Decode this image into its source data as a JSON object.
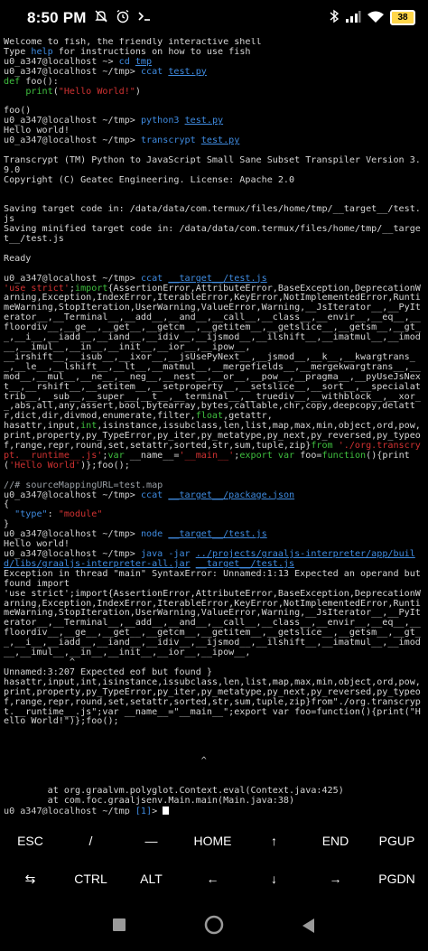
{
  "status_bar": {
    "time": "8:50 PM",
    "battery": "38",
    "icons": [
      "notifications-off-icon",
      "alarm-icon",
      "terminal-icon",
      "bluetooth-icon",
      "signal-icon",
      "wifi-icon",
      "battery-icon"
    ]
  },
  "terminal": {
    "lines": [
      [
        {
          "t": "Welcome to fish, the friendly interactive shell"
        }
      ],
      [
        {
          "t": "Type "
        },
        {
          "t": "help",
          "c": "cmd"
        },
        {
          "t": " for instructions on how to use fish"
        }
      ],
      [
        {
          "t": "u0_a347@localhost ~> ",
          "c": "prompt"
        },
        {
          "t": "cd ",
          "c": "cmd"
        },
        {
          "t": "tmp",
          "c": "file"
        }
      ],
      [
        {
          "t": "u0_a347@localhost ~/tmp> ",
          "c": "prompt"
        },
        {
          "t": "ccat ",
          "c": "cmd"
        },
        {
          "t": "test.py",
          "c": "file"
        }
      ],
      [
        {
          "t": "def",
          "c": "kw"
        },
        {
          "t": " foo():"
        }
      ],
      [
        {
          "t": "    "
        },
        {
          "t": "print",
          "c": "kw"
        },
        {
          "t": "("
        },
        {
          "t": "\"Hello World!\"",
          "c": "str"
        },
        {
          "t": ")"
        }
      ],
      [
        {
          "t": ""
        }
      ],
      [
        {
          "t": "foo()"
        }
      ],
      [
        {
          "t": "u0_a347@localhost ~/tmp> ",
          "c": "prompt"
        },
        {
          "t": "python3 ",
          "c": "cmd"
        },
        {
          "t": "test.py",
          "c": "file"
        }
      ],
      [
        {
          "t": "Hello world!"
        }
      ],
      [
        {
          "t": "u0_a347@localhost ~/tmp> ",
          "c": "prompt"
        },
        {
          "t": "transcrypt ",
          "c": "cmd"
        },
        {
          "t": "test.py",
          "c": "file"
        }
      ],
      [
        {
          "t": ""
        }
      ],
      [
        {
          "t": "Transcrypt (TM) Python to JavaScript Small Sane Subset Transpiler Version 3.9.0"
        }
      ],
      [
        {
          "t": "Copyright (C) Geatec Engineering. License: Apache 2.0"
        }
      ],
      [
        {
          "t": ""
        }
      ],
      [
        {
          "t": ""
        }
      ],
      [
        {
          "t": "Saving target code in: /data/data/com.termux/files/home/tmp/__target__/test.js"
        }
      ],
      [
        {
          "t": "Saving minified target code in: /data/data/com.termux/files/home/tmp/__target__/test.js"
        }
      ],
      [
        {
          "t": ""
        }
      ],
      [
        {
          "t": "Ready"
        }
      ],
      [
        {
          "t": ""
        }
      ],
      [
        {
          "t": "u0_a347@localhost ~/tmp> ",
          "c": "prompt"
        },
        {
          "t": "ccat ",
          "c": "cmd"
        },
        {
          "t": "__target__/test.js",
          "c": "file"
        }
      ],
      [
        {
          "t": "'use strict'",
          "c": "str"
        },
        {
          "t": ";"
        },
        {
          "t": "import",
          "c": "kw"
        },
        {
          "t": "{AssertionError,AttributeError,BaseException,DeprecationWarning,Exception,IndexError,IterableError,KeyError,NotImplementedError,RuntimeWarning,StopIteration,UserWarning,ValueError,Warning,__JsIterator__,__PyIterator__,__Terminal__,__add__,__and__,__call__,__class__,__envir__,__eq__,__floordiv__,__ge__,__get__,__getcm__,__getitem__,__getslice__,__getsm__,__gt__,__i__,__iadd__,__iand__,__idiv__,__ijsmod__,__ilshift__,__imatmul__,__imod__,__imul__,__in__,__init__,__ior__,__ipow__,"
        }
      ],
      [
        {
          "t": "__irshift__,__isub__,__ixor__,__jsUsePyNext__,__jsmod__,__k__,__kwargtrans__,__le__,__lshift__,__lt__,__matmul__,__mergefields__,__mergekwargtrans__,__mod__,__mul__,__ne__,__neg__,__nest__,__or__,__pow__,__pragma__,__pyUseJsNext__,__rshift__,__setitem__,__setproperty__,__setslice__,__sort__,__specialattrib__,__sub__,__super__,__t__,__terminal__,__truediv__,__withblock__,__xor__,abs,all,any,assert,bool,bytearray,bytes,callable,chr,copy,deepcopy,delattr,dict,dir,divmod,enumerate,filter,"
        },
        {
          "t": "float",
          "c": "kw"
        },
        {
          "t": ",getattr,"
        }
      ],
      [
        {
          "t": "hasattr,input,"
        },
        {
          "t": "int",
          "c": "kw"
        },
        {
          "t": ",isinstance,issubclass,len,list,map,max,min,object,ord,pow,print,property,py_TypeError,py_iter,py_metatype,py_next,py_reversed,py_typeof,range,repr,round,set,setattr,sorted,str,sum,tuple,zip}"
        },
        {
          "t": "from",
          "c": "kw"
        },
        {
          "t": " "
        },
        {
          "t": "'./org.transcrypt.__runtime__.js'",
          "c": "str"
        },
        {
          "t": ";"
        },
        {
          "t": "var",
          "c": "kw"
        },
        {
          "t": " __name__="
        },
        {
          "t": "'__main__'",
          "c": "str"
        },
        {
          "t": ";"
        },
        {
          "t": "export",
          "c": "kw"
        },
        {
          "t": " "
        },
        {
          "t": "var",
          "c": "kw"
        },
        {
          "t": " foo="
        },
        {
          "t": "function",
          "c": "kw"
        },
        {
          "t": "(){print("
        },
        {
          "t": "'Hello World'",
          "c": "str"
        },
        {
          "t": ")};foo();"
        }
      ],
      [
        {
          "t": ""
        }
      ],
      [
        {
          "t": "//# sourceMappingURL=test.map",
          "c": "dim"
        }
      ],
      [
        {
          "t": "u0_a347@localhost ~/tmp> ",
          "c": "prompt"
        },
        {
          "t": "ccat ",
          "c": "cmd"
        },
        {
          "t": "__target__/package.json",
          "c": "file"
        }
      ],
      [
        {
          "t": "{"
        }
      ],
      [
        {
          "t": "  "
        },
        {
          "t": "\"type\"",
          "c": "cmd"
        },
        {
          "t": ": "
        },
        {
          "t": "\"module\"",
          "c": "str"
        }
      ],
      [
        {
          "t": "}"
        }
      ],
      [
        {
          "t": "u0_a347@localhost ~/tmp> ",
          "c": "prompt"
        },
        {
          "t": "node ",
          "c": "cmd"
        },
        {
          "t": "__target__/test.js",
          "c": "file"
        }
      ],
      [
        {
          "t": "Hello world!"
        }
      ],
      [
        {
          "t": "u0_a347@localhost ~/tmp> ",
          "c": "prompt"
        },
        {
          "t": "java ",
          "c": "cmd"
        },
        {
          "t": "-jar ",
          "c": "cmd"
        },
        {
          "t": "../projects/graaljs-interpreter/app/build/libs/graaljs-interpreter-all.jar",
          "c": "file"
        },
        {
          "t": " "
        },
        {
          "t": "__target__/test.js",
          "c": "file"
        }
      ],
      [
        {
          "t": "Exception in thread \"main\" SyntaxError: Unnamed:1:13 Expected an operand but found import"
        }
      ],
      [
        {
          "t": "'use strict';import{AssertionError,AttributeError,BaseException,DeprecationWarning,Exception,IndexError,IterableError,KeyError,NotImplementedError,RuntimeWarning,StopIteration,UserWarning,ValueError,Warning,__JsIterator__,__PyIterator__,__Terminal__,__add__,__and__,__call__,__class__,__envir__,__eq__,__floordiv__,__ge__,__get__,__getcm__,__getitem__,__getslice__,__getsm__,__gt__,__i__,__iadd__,__iand__,__idiv__,__ijsmod__,__ilshift__,__imatmul__,__imod__,__imul__,__in__,__init__,__ior__,__ipow__,"
        }
      ],
      [
        {
          "t": "            ^"
        }
      ],
      [
        {
          "t": "Unnamed:3:207 Expected eof but found }"
        }
      ],
      [
        {
          "t": "hasattr,input,int,isinstance,issubclass,len,list,map,max,min,object,ord,pow,print,property,py_TypeError,py_iter,py_metatype,py_next,py_reversed,py_typeof,range,repr,round,set,setattr,sorted,str,sum,tuple,zip}from\"./org.transcrypt.__runtime__.js\";var __name__=\"__main__\";export var foo=function(){print(\"Hello World!\")};foo();"
        }
      ],
      [
        {
          "t": ""
        }
      ],
      [
        {
          "t": ""
        }
      ],
      [
        {
          "t": ""
        }
      ],
      [
        {
          "t": "                                    ^"
        }
      ],
      [
        {
          "t": ""
        }
      ],
      [
        {
          "t": ""
        }
      ],
      [
        {
          "t": "        at org.graalvm.polyglot.Context.eval(Context.java:425)"
        }
      ],
      [
        {
          "t": "        at com.foc.graaljsenv.Main.main(Main.java:38)"
        }
      ],
      [
        {
          "t": "u0_a347@localhost ~/tmp ",
          "c": "prompt"
        },
        {
          "t": "[1]",
          "c": "cmd"
        },
        {
          "t": "> ",
          "c": "prompt"
        }
      ]
    ]
  },
  "extra_keys": {
    "row1": [
      "ESC",
      "/",
      "—",
      "HOME",
      "↑",
      "END",
      "PGUP"
    ],
    "row2": [
      "⇆",
      "CTRL",
      "ALT",
      "←",
      "↓",
      "→",
      "PGDN"
    ]
  },
  "nav_bar": {
    "buttons": [
      "recents-button",
      "home-button",
      "back-button"
    ]
  }
}
